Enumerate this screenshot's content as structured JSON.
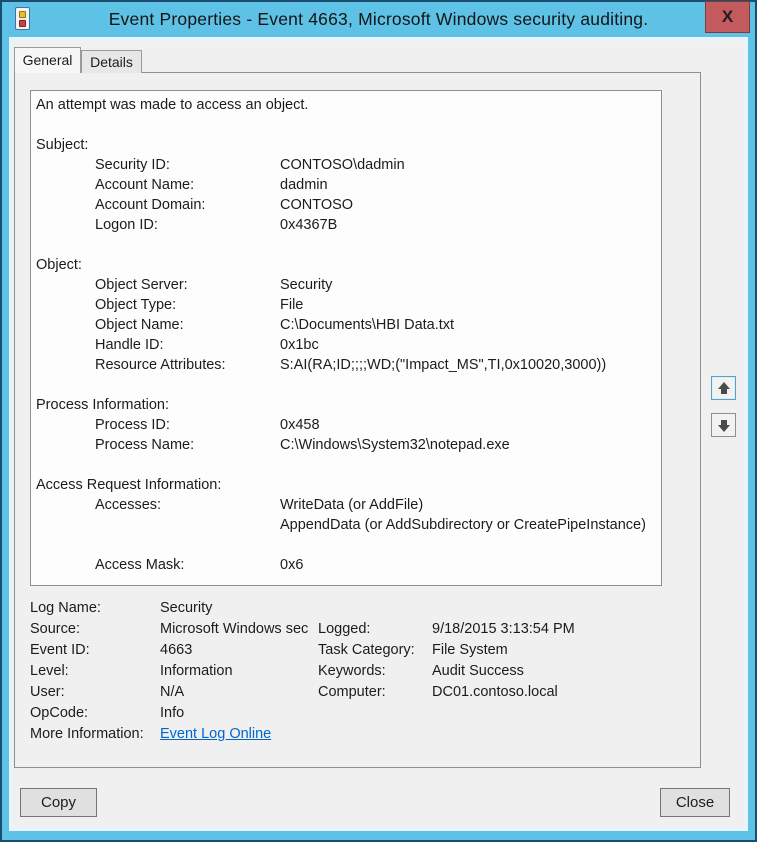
{
  "window": {
    "title": "Event Properties - Event 4663, Microsoft Windows security auditing.",
    "close_glyph": "X"
  },
  "icons": {
    "titlebar": "event-properties-icon",
    "close": "close-icon",
    "scroll_up": "arrow-up-icon",
    "scroll_down": "arrow-down-icon"
  },
  "colors": {
    "frame_accent": "#5dc2e5",
    "frame_outline": "#1b4d6e",
    "close_button": "#c35a5d",
    "link": "#0066cc",
    "dialog_bg": "#f0f0f0"
  },
  "tabs": [
    {
      "label": "General"
    },
    {
      "label": "Details"
    }
  ],
  "description": {
    "intro": "An attempt was made to access an object.",
    "sections": [
      {
        "title": "Subject:",
        "rows": [
          {
            "label": "Security ID:",
            "value": "CONTOSO\\dadmin"
          },
          {
            "label": "Account Name:",
            "value": "dadmin"
          },
          {
            "label": "Account Domain:",
            "value": "CONTOSO"
          },
          {
            "label": "Logon ID:",
            "value": "0x4367B"
          }
        ]
      },
      {
        "title": "Object:",
        "rows": [
          {
            "label": "Object Server:",
            "value": "Security"
          },
          {
            "label": "Object Type:",
            "value": "File"
          },
          {
            "label": "Object Name:",
            "value": "C:\\Documents\\HBI Data.txt"
          },
          {
            "label": "Handle ID:",
            "value": "0x1bc"
          },
          {
            "label": "Resource Attributes:",
            "value": "S:AI(RA;ID;;;;WD;(\"Impact_MS\",TI,0x10020,3000))"
          }
        ]
      },
      {
        "title": "Process Information:",
        "rows": [
          {
            "label": "Process ID:",
            "value": "0x458"
          },
          {
            "label": "Process Name:",
            "value": "C:\\Windows\\System32\\notepad.exe"
          }
        ]
      },
      {
        "title": "Access Request Information:",
        "rows": [
          {
            "label": "Accesses:",
            "value": "WriteData (or AddFile)"
          },
          {
            "label": "",
            "value": "AppendData (or AddSubdirectory or CreatePipeInstance)"
          },
          {
            "label": "Access Mask:",
            "value": "0x6"
          }
        ]
      }
    ]
  },
  "footer": {
    "left": [
      {
        "label": "Log Name:",
        "value": "Security"
      },
      {
        "label": "Source:",
        "value": "Microsoft Windows sec"
      },
      {
        "label": "Event ID:",
        "value": "4663"
      },
      {
        "label": "Level:",
        "value": "Information"
      },
      {
        "label": "User:",
        "value": "N/A"
      },
      {
        "label": "OpCode:",
        "value": "Info"
      },
      {
        "label": "More Information:",
        "value": ""
      }
    ],
    "right": [
      {
        "label": "Logged:",
        "value": "9/18/2015 3:13:54 PM"
      },
      {
        "label": "Task Category:",
        "value": "File System"
      },
      {
        "label": "Keywords:",
        "value": "Audit Success"
      },
      {
        "label": "Computer:",
        "value": "DC01.contoso.local"
      }
    ],
    "more_info_link": "Event Log Online"
  },
  "buttons": {
    "copy": "Copy",
    "close": "Close"
  }
}
